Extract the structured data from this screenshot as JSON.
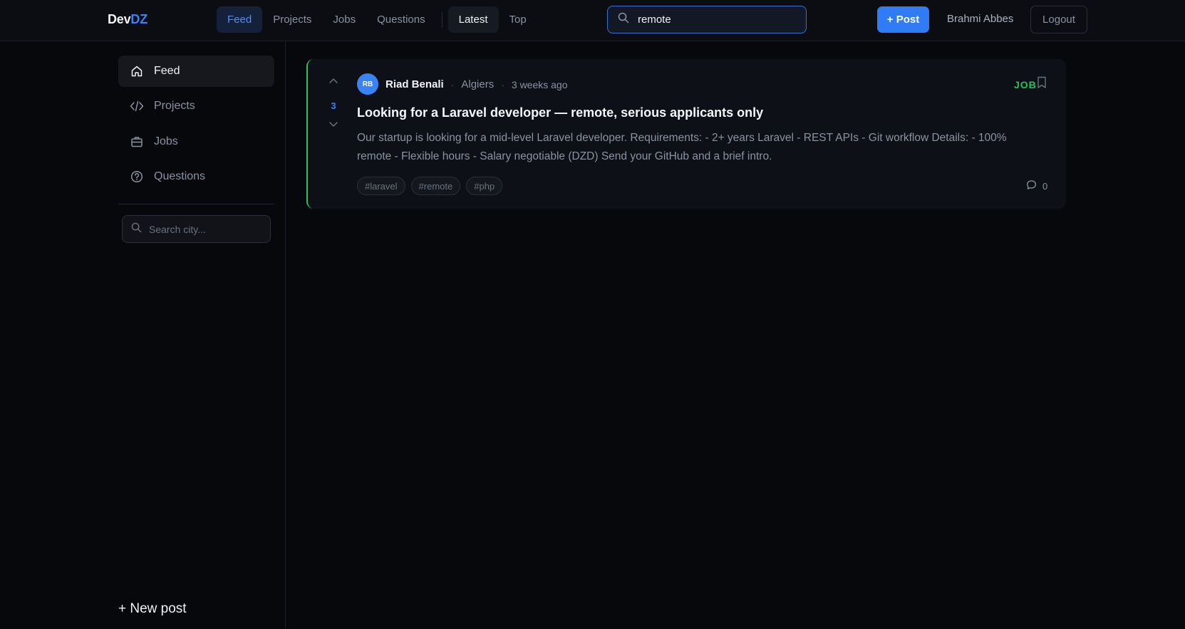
{
  "brand": {
    "dev": "Dev",
    "dz": "DZ"
  },
  "topnav": {
    "items": [
      {
        "label": "Feed",
        "active": true
      },
      {
        "label": "Projects",
        "active": false
      },
      {
        "label": "Jobs",
        "active": false
      },
      {
        "label": "Questions",
        "active": false
      }
    ],
    "sort": [
      {
        "label": "Latest",
        "active": true
      },
      {
        "label": "Top",
        "active": false
      }
    ]
  },
  "search": {
    "value": "remote",
    "icon": "search-icon"
  },
  "header": {
    "post_label": "+ Post",
    "username": "Brahmi Abbes",
    "logout_label": "Logout"
  },
  "sidebar": {
    "items": [
      {
        "label": "Feed",
        "icon": "home-icon",
        "active": true
      },
      {
        "label": "Projects",
        "icon": "code-icon",
        "active": false
      },
      {
        "label": "Jobs",
        "icon": "briefcase-icon",
        "active": false
      },
      {
        "label": "Questions",
        "icon": "help-circle-icon",
        "active": false
      }
    ],
    "city_search": {
      "placeholder": "Search city...",
      "value": ""
    },
    "new_post_label": "+ New post"
  },
  "posts": [
    {
      "votes": "3",
      "avatar_initials": "RB",
      "author": "Riad Benali",
      "city": "Algiers",
      "time": "3 weeks ago",
      "type": "JOB",
      "title": "Looking for a Laravel developer — remote, serious applicants only",
      "body": "Our startup is looking for a mid-level Laravel developer. Requirements: - 2+ years Laravel - REST APIs - Git workflow Details: - 100% remote - Flexible hours - Salary negotiable (DZD) Send your GitHub and a brief intro.",
      "tags": [
        "#laravel",
        "#remote",
        "#php"
      ],
      "comments": "0"
    }
  ],
  "colors": {
    "accent": "#3b82f6",
    "job": "#22c55e",
    "background": "#07080b"
  }
}
